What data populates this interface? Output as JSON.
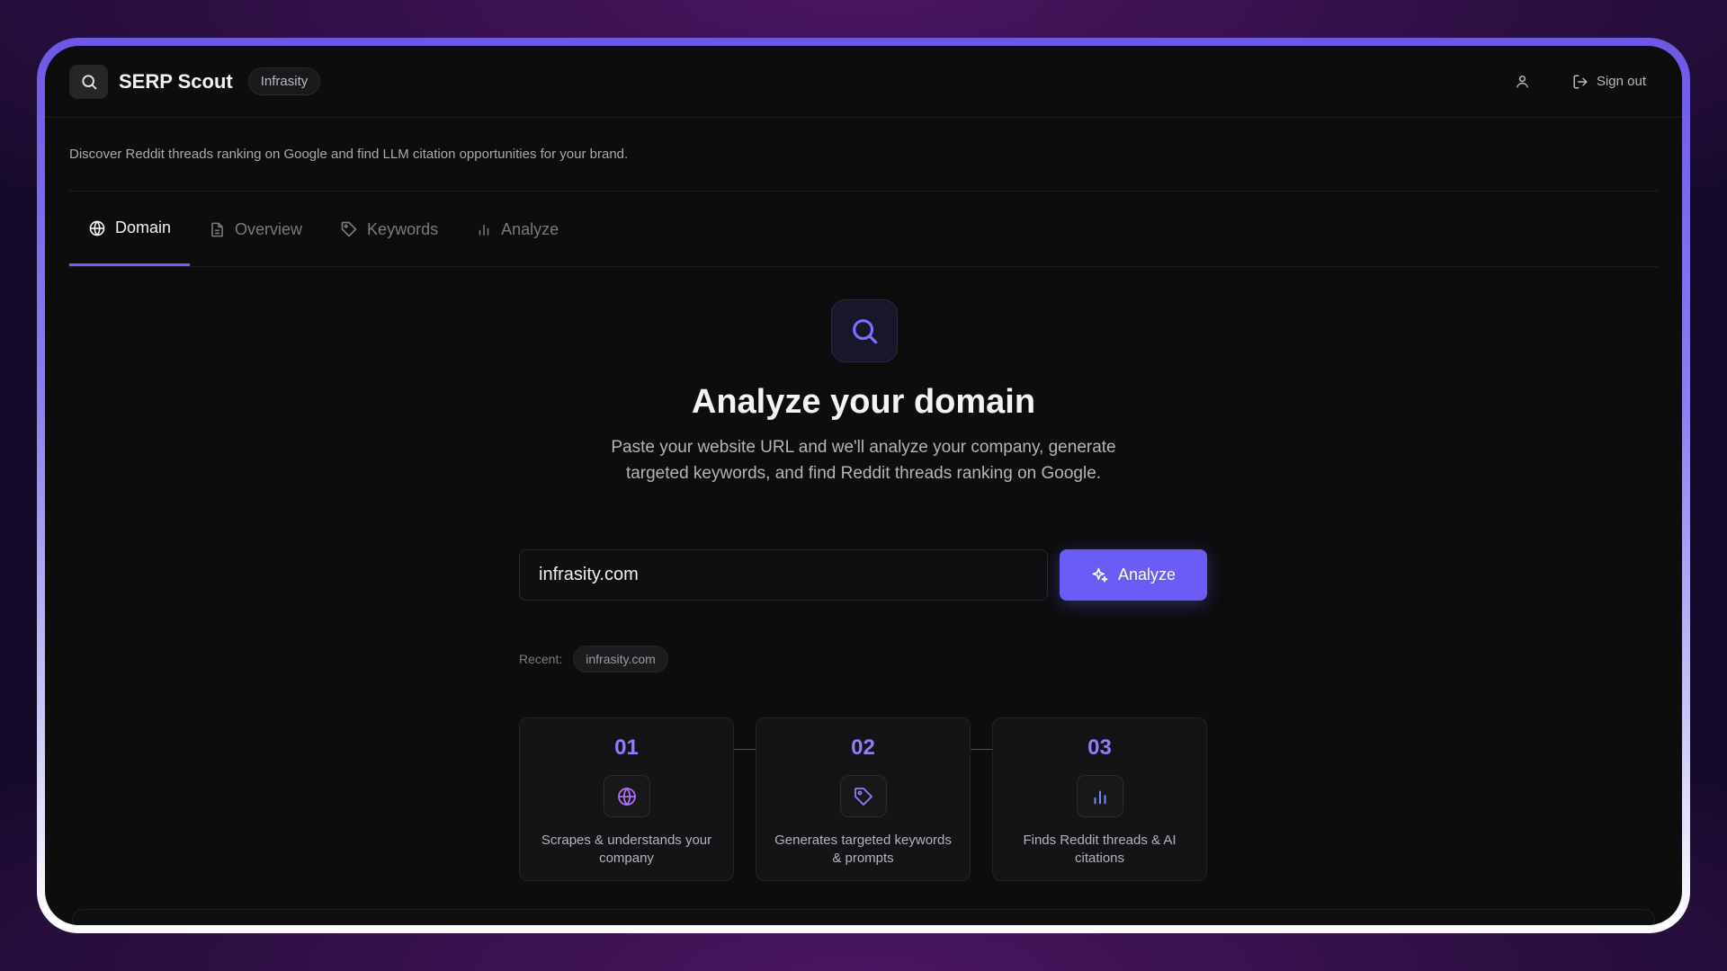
{
  "app": {
    "title": "SERP Scout",
    "workspace": "Infrasity",
    "tagline": "Discover Reddit threads ranking on Google and find LLM citation opportunities for your brand."
  },
  "header": {
    "signout_label": "Sign out"
  },
  "tabs": [
    {
      "label": "Domain",
      "icon": "globe-icon",
      "active": true
    },
    {
      "label": "Overview",
      "icon": "document-icon",
      "active": false
    },
    {
      "label": "Keywords",
      "icon": "tag-icon",
      "active": false
    },
    {
      "label": "Analyze",
      "icon": "bar-chart-icon",
      "active": false
    }
  ],
  "hero": {
    "title": "Analyze your domain",
    "description": "Paste your website URL and we'll analyze your company, generate targeted keywords, and find Reddit threads ranking on Google."
  },
  "form": {
    "url_value": "infrasity.com",
    "analyze_label": "Analyze"
  },
  "recent": {
    "label": "Recent:",
    "items": [
      "infrasity.com"
    ]
  },
  "steps": [
    {
      "num": "01",
      "icon": "globe-icon",
      "text": "Scrapes & understands your company"
    },
    {
      "num": "02",
      "icon": "tag-icon",
      "text": "Generates targeted keywords & prompts"
    },
    {
      "num": "03",
      "icon": "bar-chart-icon",
      "text": "Finds Reddit threads & AI citations"
    }
  ],
  "colors": {
    "accent": "#6a5cf5",
    "step_number": "#8b80f5",
    "background": "#0d0d0e"
  }
}
